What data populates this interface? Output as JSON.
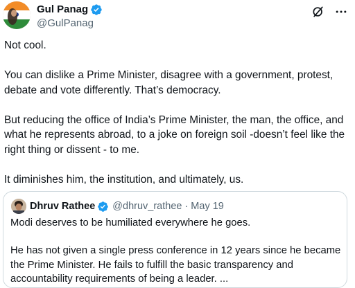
{
  "author": {
    "name": "Gul Panag",
    "handle": "@GulPanag"
  },
  "tweet": {
    "text": "Not cool.\n\nYou can dislike a Prime Minister, disagree with a government, protest, debate and vote differently. That’s democracy.\n\nBut reducing the office of India’s Prime Minister, the man, the office, and what he represents abroad, to a joke on foreign soil -doesn’t feel like the right thing or dissent - to me.\n\nIt diminishes him, the institution, and ultimately, us."
  },
  "quote": {
    "name": "Dhruv Rathee",
    "handle": "@dhruv_rathee",
    "separator": "·",
    "date": "May 19",
    "text": "Modi deserves to be humiliated everywhere he goes.\n\nHe has not given a single press conference in 12 years since he became the Prime Minister. He fails to fulfill the basic transparency and accountability requirements of being a leader. ..."
  },
  "icons": {
    "verified": "verified-badge-icon",
    "grok": "grok-icon",
    "more": "more-options-icon"
  },
  "colors": {
    "verified_blue": "#1d9bf0",
    "secondary_text": "#536471",
    "border": "#cfd9de"
  }
}
